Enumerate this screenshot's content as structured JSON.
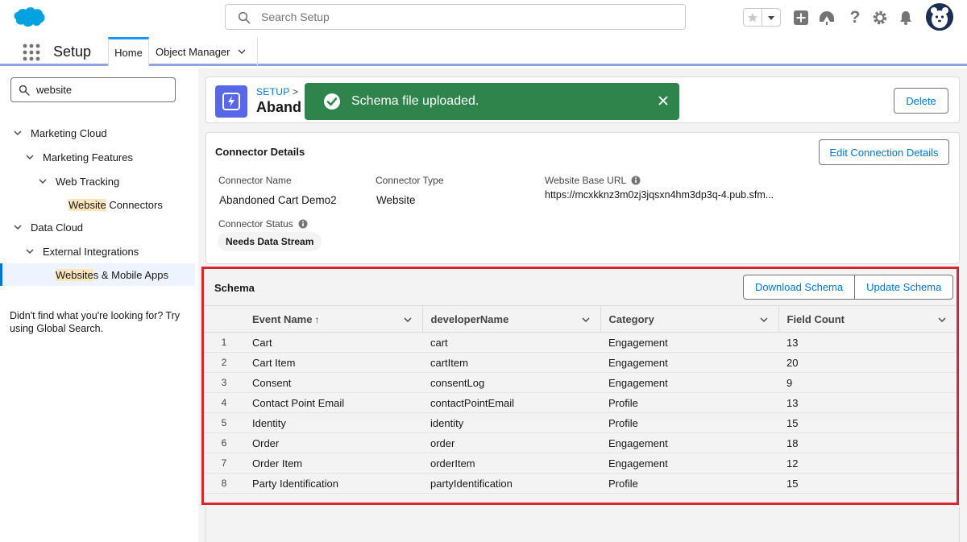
{
  "header": {
    "search_placeholder": "Search Setup",
    "icons": [
      "salesforce-cloud-logo",
      "search-icon",
      "star-icon",
      "chevron-down-icon",
      "add-icon",
      "trailhead-icon",
      "help-icon",
      "gear-icon",
      "bell-icon",
      "avatar"
    ]
  },
  "context_bar": {
    "app_name": "Setup",
    "tabs": [
      {
        "label": "Home"
      },
      {
        "label": "Object Manager"
      }
    ]
  },
  "left_nav": {
    "quickfind_value": "website",
    "tree": {
      "marketing_cloud": "Marketing Cloud",
      "marketing_features": "Marketing Features",
      "web_tracking": "Web Tracking",
      "website_connectors_hl": "Website",
      "website_connectors_rest": " Connectors",
      "data_cloud": "Data Cloud",
      "external_integrations": "External Integrations",
      "websites_mobile_hl": "Website",
      "websites_mobile_rest": "s & Mobile Apps"
    },
    "footer": "Didn't find what you're looking for? Try using Global Search."
  },
  "page_header": {
    "breadcrumb": "SETUP",
    "breadcrumb_sep": ">",
    "title": "Aband",
    "delete_label": "Delete"
  },
  "toast": {
    "message": "Schema file uploaded.",
    "close_glyph": "✕"
  },
  "connector_details": {
    "title": "Connector Details",
    "edit_label": "Edit Connection Details",
    "fields": {
      "name_label": "Connector Name",
      "name_value": "Abandoned Cart Demo2",
      "type_label": "Connector Type",
      "type_value": "Website",
      "url_label": "Website Base URL",
      "url_value": "https://mcxkknz3m0zj3jqsxn4hm3dp3q-4.pub.sfm...",
      "status_label": "Connector Status",
      "status_value": "Needs Data Stream"
    }
  },
  "schema": {
    "title": "Schema",
    "download_label": "Download Schema",
    "update_label": "Update Schema",
    "columns": [
      "Event Name",
      "developerName",
      "Category",
      "Field Count"
    ],
    "sort_arrow": "↑",
    "rows": [
      {
        "n": "1",
        "event": "Cart",
        "dev": "cart",
        "cat": "Engagement",
        "count": "13"
      },
      {
        "n": "2",
        "event": "Cart Item",
        "dev": "cartItem",
        "cat": "Engagement",
        "count": "20"
      },
      {
        "n": "3",
        "event": "Consent",
        "dev": "consentLog",
        "cat": "Engagement",
        "count": "9"
      },
      {
        "n": "4",
        "event": "Contact Point Email",
        "dev": "contactPointEmail",
        "cat": "Profile",
        "count": "13"
      },
      {
        "n": "5",
        "event": "Identity",
        "dev": "identity",
        "cat": "Profile",
        "count": "15"
      },
      {
        "n": "6",
        "event": "Order",
        "dev": "order",
        "cat": "Engagement",
        "count": "18"
      },
      {
        "n": "7",
        "event": "Order Item",
        "dev": "orderItem",
        "cat": "Engagement",
        "count": "12"
      },
      {
        "n": "8",
        "event": "Party Identification",
        "dev": "partyIdentification",
        "cat": "Profile",
        "count": "15"
      }
    ]
  },
  "colors": {
    "brand_blue": "#0176d3",
    "toast_green": "#2e844a",
    "highlight_frame": "#d9252f",
    "object_icon": "#5867e8"
  }
}
